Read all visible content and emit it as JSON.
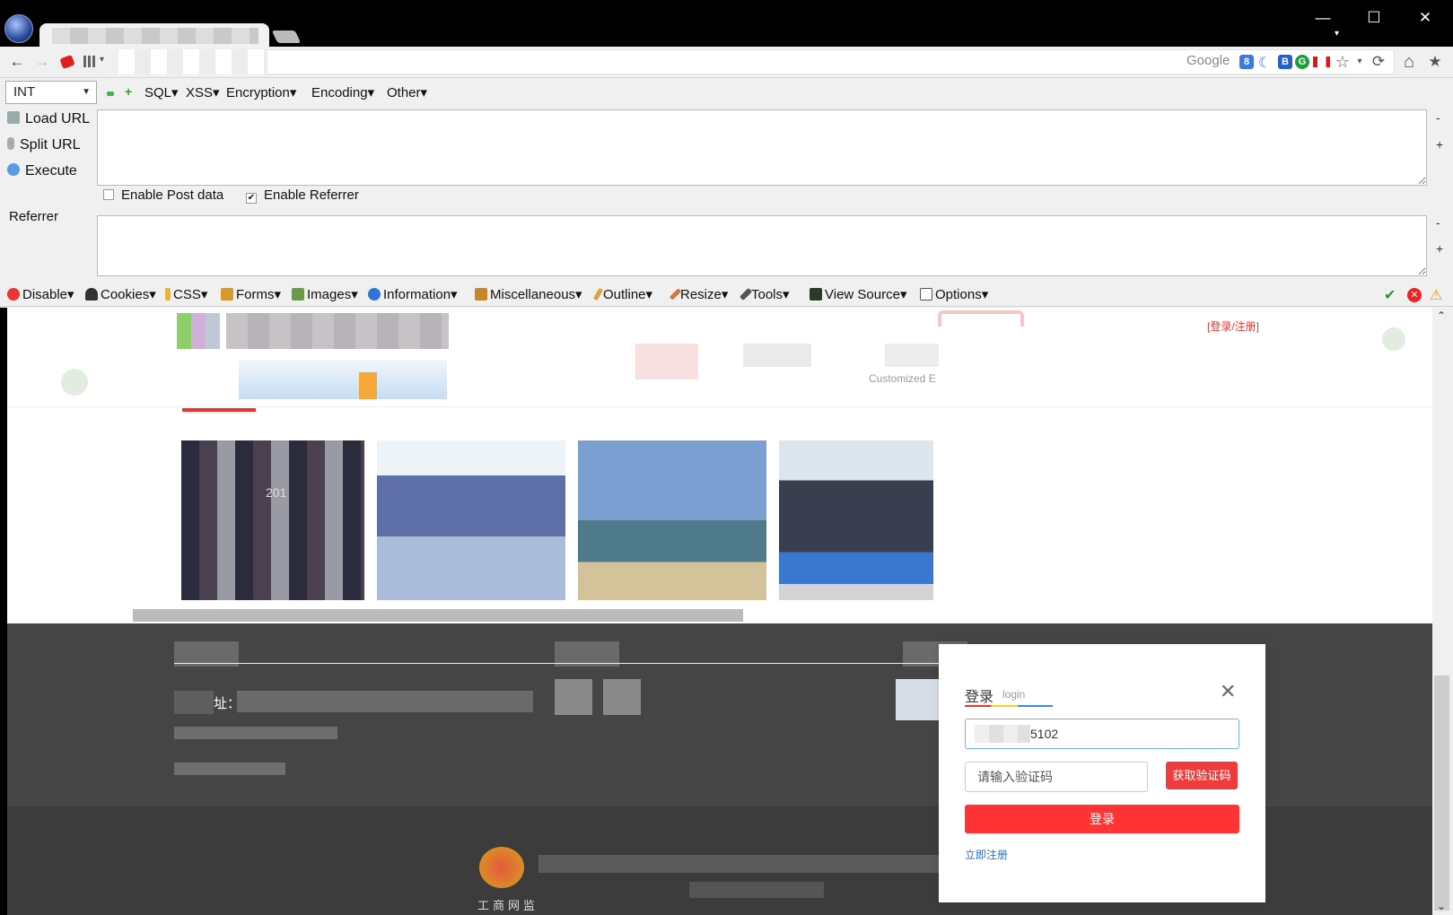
{
  "window": {
    "minimize": "—",
    "maximize": "☐",
    "close": "✕",
    "menu_arrow": "▾"
  },
  "navbar": {
    "back": "←",
    "forward": "→",
    "search_engine_label": "Google",
    "reload": "⟳",
    "home": "⌂",
    "bookmark": "★",
    "star": "☆",
    "dropdown": "▾"
  },
  "hackbar": {
    "type_select": "INT",
    "menus": [
      "SQL",
      "XSS",
      "Encryption",
      "Encoding",
      "Other"
    ],
    "load_url": "Load URL",
    "split_url": "Split URL",
    "execute": "Execute",
    "enable_post": "Enable Post data",
    "enable_referrer": "Enable Referrer",
    "enable_post_checked": false,
    "enable_referrer_checked": true,
    "referrer_label": "Referrer",
    "minus": "-",
    "plus": "+",
    "url_value": "",
    "referrer_value": ""
  },
  "webdev": {
    "items": [
      "Disable",
      "Cookies",
      "CSS",
      "Forms",
      "Images",
      "Information",
      "Miscellaneous",
      "Outline",
      "Resize",
      "Tools",
      "View Source",
      "Options"
    ]
  },
  "page": {
    "top_link": "[登录/注册]",
    "customized_text": "Customized E",
    "address_label": "址：",
    "footer_logo_text": "工商网监",
    "photo_text": "201"
  },
  "login": {
    "title": "登录",
    "subtitle": "login",
    "close_icon": "✕",
    "phone_value": "5102",
    "code_placeholder": "请输入验证码",
    "get_code": "获取验证码",
    "submit": "登录",
    "register": "立即注册"
  },
  "colors": {
    "accent_red": "#ef3b3b",
    "link_blue": "#2a6fd0",
    "footer_dark": "#454545"
  }
}
